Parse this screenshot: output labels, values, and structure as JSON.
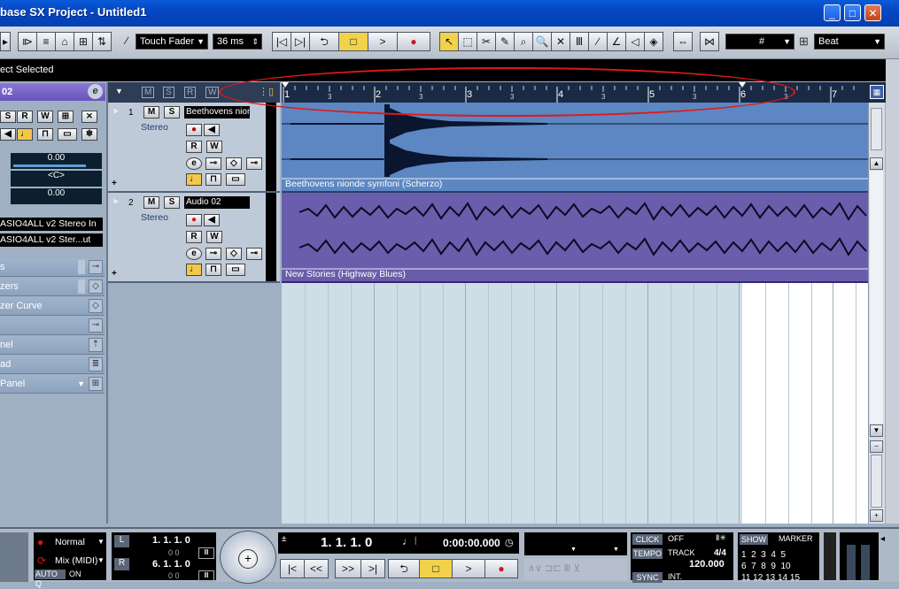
{
  "window": {
    "title": "base SX Project - Untitled1",
    "controls": [
      "_",
      "□",
      "✕"
    ]
  },
  "toolbar": {
    "automation_mode": "Touch Fader",
    "time_value": "36 ms",
    "snap_grid_symbol": "#",
    "quantize": "Beat"
  },
  "infoline": {
    "text": "ect Selected"
  },
  "inspector": {
    "track_name": "02",
    "buttons_row1": [
      "S",
      "R",
      "W"
    ],
    "volume": "0.00",
    "pan": "<C>",
    "delay": "0.00",
    "input_routing": "ASIO4ALL v2 Stereo In",
    "output_routing": "ASIO4ALL v2 Ster...ut",
    "sections": [
      "s",
      "zers",
      "zer Curve",
      "",
      "nel",
      "ad",
      "Panel"
    ]
  },
  "tracklist": {
    "header_buttons": [
      "M",
      "S",
      "R",
      "W"
    ],
    "tracks": [
      {
        "number": "1",
        "name": "Beethovens nionde",
        "type": "Stereo",
        "mute": "M",
        "solo": "S",
        "read": "R",
        "write": "W"
      },
      {
        "number": "2",
        "name": "Audio 02",
        "type": "Stereo",
        "mute": "M",
        "solo": "S",
        "read": "R",
        "write": "W"
      }
    ]
  },
  "ruler": {
    "bars": [
      "1",
      "2",
      "3",
      "4",
      "5",
      "6",
      "7"
    ],
    "subdivision": "3"
  },
  "events": [
    {
      "name": "Beethovens nionde symfoni (Scherzo)",
      "color": "#5c87c2"
    },
    {
      "name": "New Stories (Highway Blues)",
      "color": "#6a5dac"
    }
  ],
  "transport": {
    "mode": "Normal",
    "record_mode": "Mix (MIDI)",
    "auto_q": "AUTO Q",
    "auto_q_state": "ON",
    "left_locator": "1. 1. 1.  0",
    "left_locator_sub": "0    0",
    "right_locator": "6. 1. 1.  0",
    "right_locator_sub": "0    0",
    "position_bars": "1. 1. 1.   0",
    "position_time": "0:00:00.000",
    "click_label": "CLICK",
    "click_state": "OFF",
    "tempo_label": "TEMPO",
    "tempo_mode": "TRACK",
    "signature": "4/4",
    "tempo_value": "120.000",
    "sync_label": "SYNC",
    "sync_state": "INT.",
    "show_label": "SHOW",
    "marker_label": "MARKER",
    "markers": [
      "1",
      "2",
      "3",
      "4",
      "5",
      "6",
      "7",
      "8",
      "9",
      "10",
      "11",
      "12",
      "13",
      "14",
      "15"
    ]
  },
  "colors": {
    "accent_purple": "#7b68c8",
    "event_blue": "#5c87c2",
    "event_purple": "#6a5dac",
    "annotation_red": "#e01818"
  }
}
